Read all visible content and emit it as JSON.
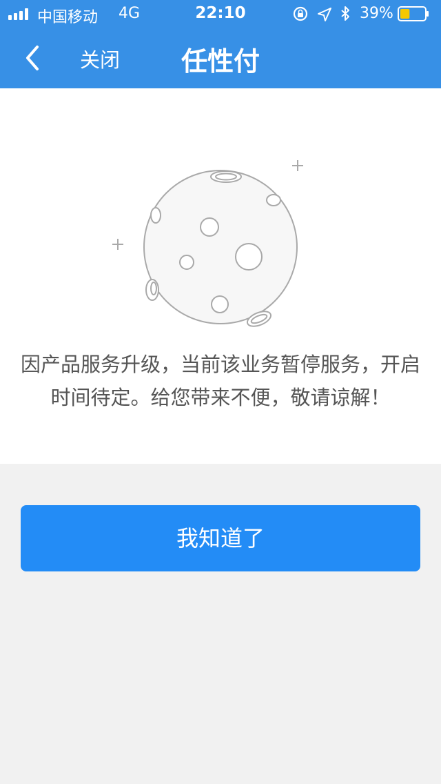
{
  "status_bar": {
    "carrier": "中国移动",
    "network": "4G",
    "time": "22:10",
    "battery_percent": "39%",
    "battery_level": 0.39,
    "icons": [
      "signal-icon",
      "rotation-lock-icon",
      "location-icon",
      "bluetooth-icon",
      "battery-icon"
    ]
  },
  "nav": {
    "back_icon": "chevron-left-icon",
    "close_label": "关闭",
    "title": "任性付"
  },
  "notice": {
    "illustration": "moon-icon",
    "message": "因产品服务升级，当前该业务暂停服务，开启时间待定。给您带来不便，敬请谅解！"
  },
  "action": {
    "confirm_label": "我知道了"
  },
  "colors": {
    "header_bg": "#3790e6",
    "button_bg": "#238cf6",
    "page_bg": "#f1f1f1",
    "battery_fill": "#f5c800"
  }
}
